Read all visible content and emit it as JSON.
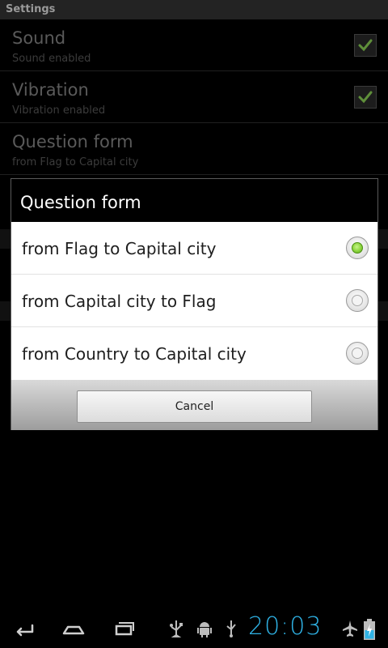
{
  "app": {
    "title": "Settings"
  },
  "preferences": [
    {
      "title": "Sound",
      "summary": "Sound enabled",
      "checked": true
    },
    {
      "title": "Vibration",
      "summary": "Vibration enabled",
      "checked": true
    },
    {
      "title": "Question form",
      "summary": "from Flag to Capital city"
    }
  ],
  "dialog": {
    "title": "Question form",
    "options": [
      {
        "label": "from Flag to Capital city",
        "selected": true
      },
      {
        "label": "from Capital city to Flag",
        "selected": false
      },
      {
        "label": "from Country to Capital city",
        "selected": false
      }
    ],
    "cancel_label": "Cancel"
  },
  "status_bar": {
    "time": "20:03"
  },
  "colors": {
    "accent": "#2fb3e6",
    "radio_selected": "#8ad43c",
    "check": "#7ec24a"
  },
  "icons": {
    "nav": [
      "back-icon",
      "home-icon",
      "recent-apps-icon"
    ],
    "status": [
      "usb-debug-icon",
      "android-icon",
      "usb-icon",
      "airplane-mode-icon",
      "battery-charging-icon"
    ]
  }
}
